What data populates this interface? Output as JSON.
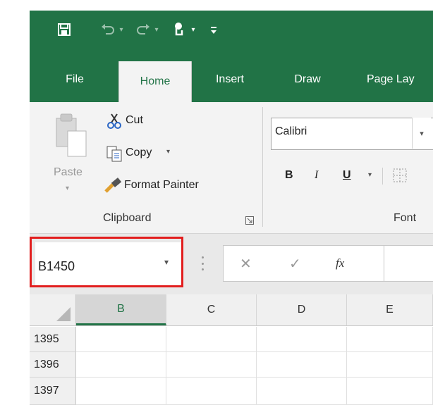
{
  "quick_access": {
    "save_icon": "save-icon",
    "undo_icon": "undo-icon",
    "redo_icon": "redo-icon",
    "touch_icon": "touch-mode-icon",
    "customize_icon": "customize-qat-icon"
  },
  "tabs": [
    "File",
    "Home",
    "Insert",
    "Draw",
    "Page Lay"
  ],
  "clipboard": {
    "paste_label": "Paste",
    "cut_label": "Cut",
    "copy_label": "Copy",
    "format_painter_label": "Format Painter",
    "group_label": "Clipboard"
  },
  "font": {
    "font_name": "Calibri",
    "bold": "B",
    "italic": "I",
    "underline": "U",
    "group_label": "Font"
  },
  "formula_bar": {
    "name_box_value": "B1450",
    "cancel_symbol": "✕",
    "enter_symbol": "✓",
    "fx_label": "fx"
  },
  "columns": [
    "B",
    "C",
    "D",
    "E"
  ],
  "rows": [
    "1395",
    "1396",
    "1397"
  ],
  "colors": {
    "excel_green": "#217346",
    "highlight_red": "#e21e1e"
  }
}
